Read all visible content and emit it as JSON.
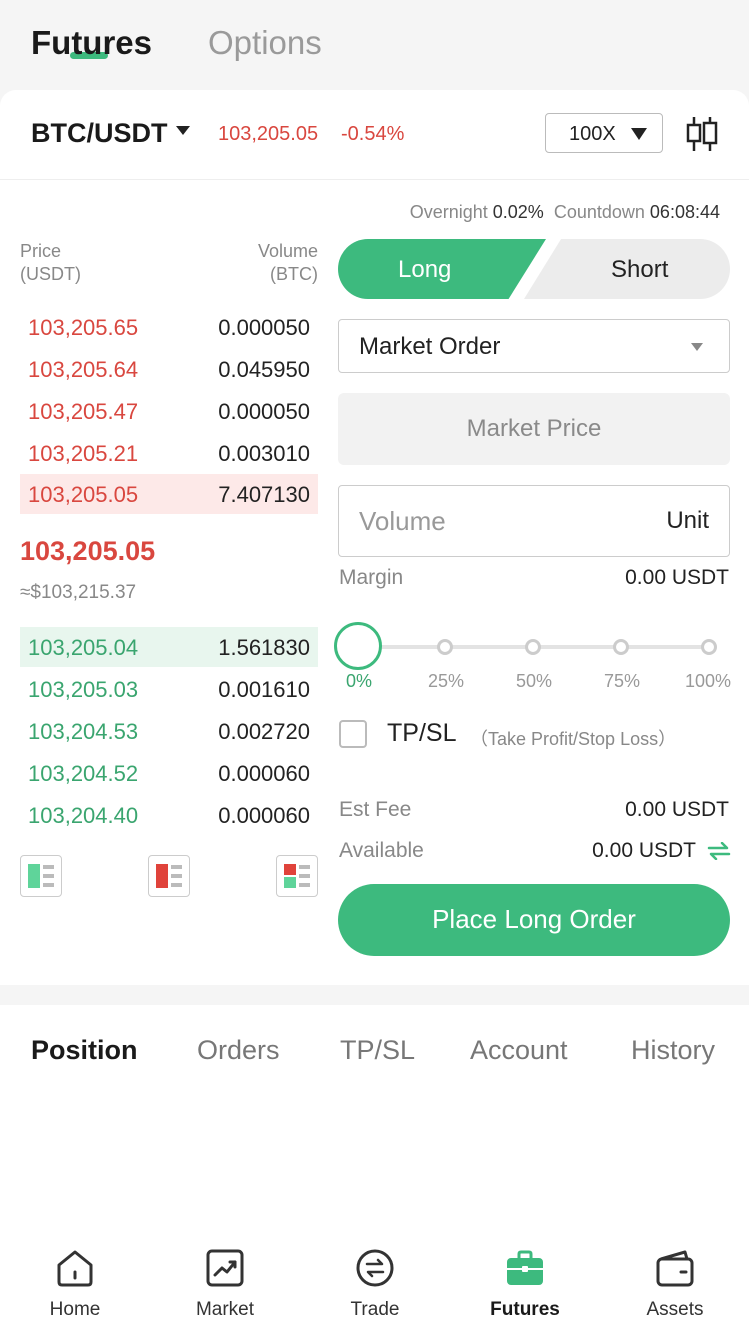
{
  "top_tabs": {
    "futures": "Futures",
    "options": "Options"
  },
  "pair": {
    "name": "BTC/USDT",
    "price": "103,205.05",
    "change": "-0.54%",
    "leverage": "100X"
  },
  "funding": {
    "overnight_label": "Overnight",
    "overnight_value": "0.02%",
    "countdown_label": "Countdown",
    "countdown_value": "06:08:44"
  },
  "orderbook": {
    "price_header_1": "Price",
    "price_header_2": "(USDT)",
    "volume_header_1": "Volume",
    "volume_header_2": "(BTC)",
    "asks": [
      {
        "price": "103,205.65",
        "volume": "0.000050"
      },
      {
        "price": "103,205.64",
        "volume": "0.045950"
      },
      {
        "price": "103,205.47",
        "volume": "0.000050"
      },
      {
        "price": "103,205.21",
        "volume": "0.003010"
      },
      {
        "price": "103,205.05",
        "volume": "7.407130"
      }
    ],
    "last_price": "103,205.05",
    "last_fiat": "≈$103,215.37",
    "bids": [
      {
        "price": "103,205.04",
        "volume": "1.561830"
      },
      {
        "price": "103,205.03",
        "volume": "0.001610"
      },
      {
        "price": "103,204.53",
        "volume": "0.002720"
      },
      {
        "price": "103,204.52",
        "volume": "0.000060"
      },
      {
        "price": "103,204.40",
        "volume": "0.000060"
      }
    ]
  },
  "form": {
    "long_label": "Long",
    "short_label": "Short",
    "order_type": "Market Order",
    "market_price": "Market Price",
    "volume_placeholder": "Volume",
    "volume_unit": "Unit",
    "margin_label": "Margin",
    "margin_value": "0.00 USDT",
    "slider_value_percent": 0,
    "slider_labels": [
      "0%",
      "25%",
      "50%",
      "75%",
      "100%"
    ],
    "tpsl_label": "TP/SL",
    "tpsl_hint": "（Take Profit/Stop Loss）",
    "fee_label": "Est Fee",
    "fee_value": "0.00 USDT",
    "available_label": "Available",
    "available_value": "0.00 USDT",
    "submit_label": "Place Long Order"
  },
  "position_tabs": [
    "Position",
    "Orders",
    "TP/SL",
    "Account",
    "History"
  ],
  "nav": [
    {
      "label": "Home",
      "icon": "home-icon"
    },
    {
      "label": "Market",
      "icon": "market-chart-icon"
    },
    {
      "label": "Trade",
      "icon": "trade-exchange-icon"
    },
    {
      "label": "Futures",
      "icon": "futures-briefcase-icon"
    },
    {
      "label": "Assets",
      "icon": "wallet-icon"
    }
  ],
  "colors": {
    "green": "#3dba7e",
    "red": "#d9473f"
  }
}
